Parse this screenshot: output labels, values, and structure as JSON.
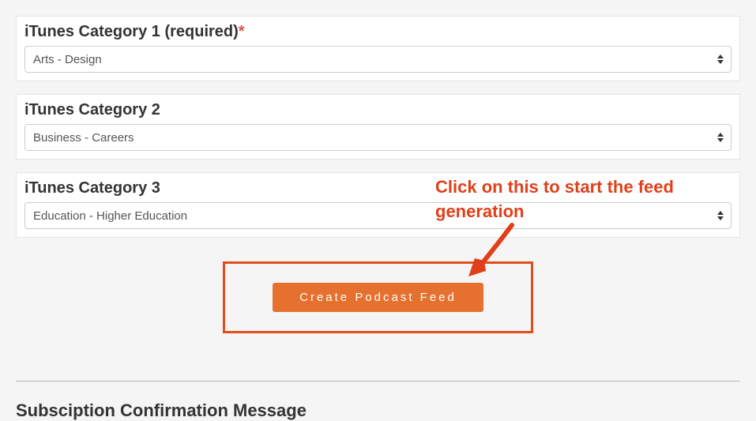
{
  "categories": [
    {
      "label": "iTunes Category 1 (required)",
      "required": true,
      "value": "Arts - Design"
    },
    {
      "label": "iTunes Category 2",
      "required": false,
      "value": "Business - Careers"
    },
    {
      "label": "iTunes Category 3",
      "required": false,
      "value": "Education - Higher Education"
    }
  ],
  "button": {
    "create_label": "Create Podcast Feed"
  },
  "annotation": {
    "text": "Click on this to start the feed generation"
  },
  "section": {
    "subscription_title": "Subsciption Confirmation Message"
  }
}
